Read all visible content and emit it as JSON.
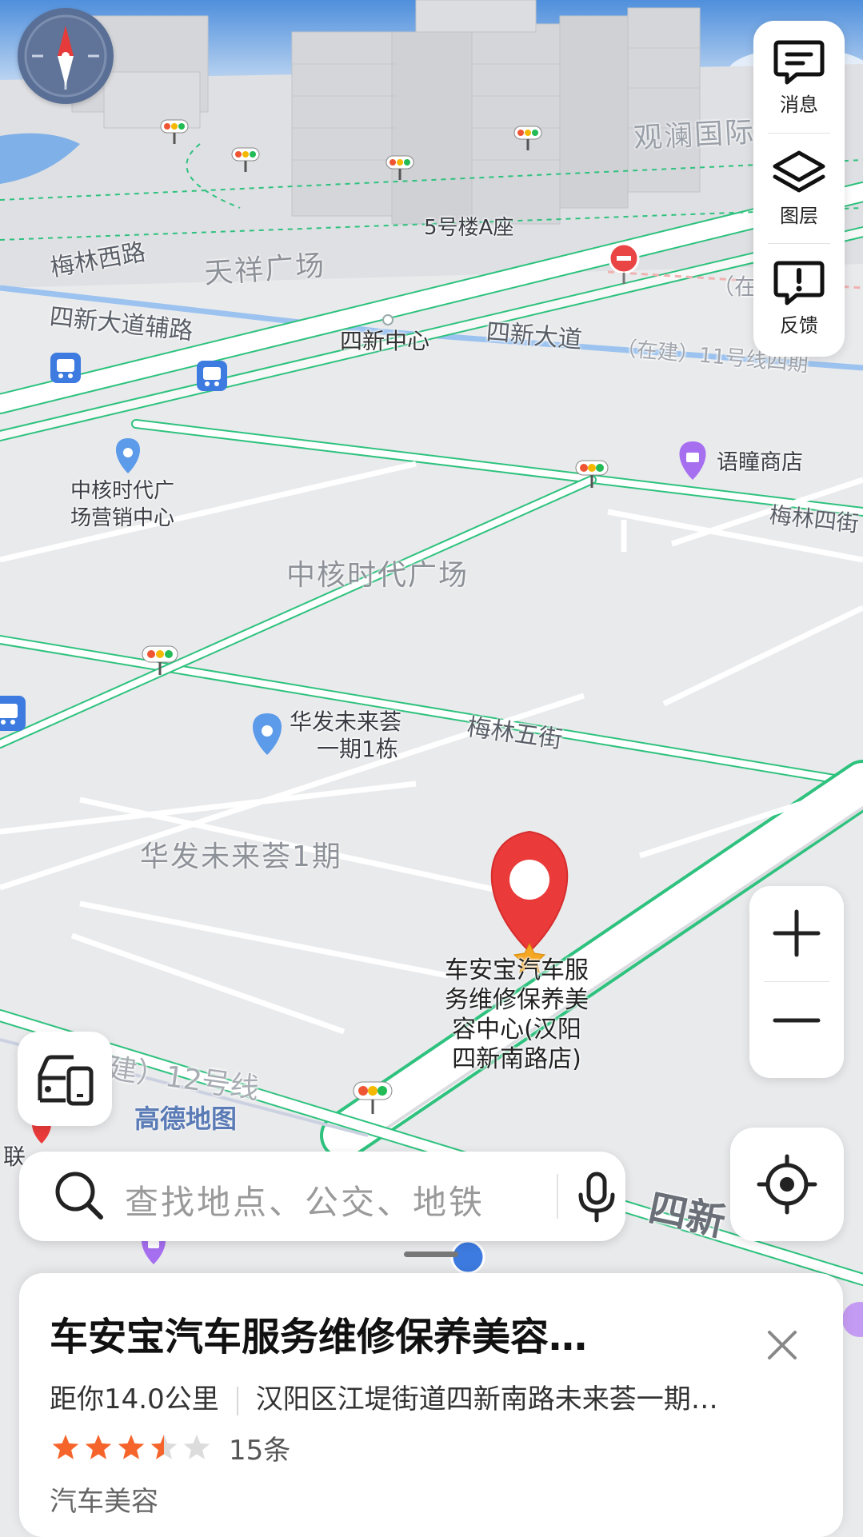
{
  "map": {
    "road_labels": {
      "meilin_west": "梅林西路",
      "sixin_aux": "四新大道辅路",
      "sixin_center": "四新中心",
      "sixin_avenue": "四新大道",
      "meilin_four": "梅林四街",
      "meilin_five": "梅林五街",
      "under_construction_11": "（在建）11号线四期",
      "under_construction_left": "（在",
      "line12": "建）12号线",
      "sixin_bottom": "四新"
    },
    "area_labels": {
      "tianxiang": "天祥广场",
      "zhonghe_plaza": "中核时代广场",
      "huafa_phase1": "华发未来荟1期",
      "guanlan": "观澜国际"
    },
    "poi_labels": {
      "building5a": "5号楼A座",
      "zhonghe_sales_1": "中核时代广",
      "zhonghe_sales_2": "场营销中心",
      "yutong_shop": "语瞳商店",
      "huafa_building_1": "华发未来荟",
      "huafa_building_2": "一期1栋",
      "target_1": "车安宝汽车服",
      "target_2": "务维修保养美",
      "target_3": "容中心(汉阳",
      "target_4": "四新南路店)",
      "lianfeng": "联"
    },
    "watermark": "高德地图"
  },
  "tools": {
    "messages": "消息",
    "layers": "图层",
    "feedback": "反馈"
  },
  "search": {
    "placeholder": "查找地点、公交、地铁"
  },
  "place_card": {
    "title": "车安宝汽车服务维修保养美容…",
    "distance": "距你14.0公里",
    "address": "汉阳区江堤街道四新南路未来荟一期…",
    "rating": 3.5,
    "review_count": "15条",
    "category": "汽车美容"
  },
  "colors": {
    "accent_green": "#2ec27e",
    "marker_red": "#ea3a3a",
    "star_orange": "#f5652b",
    "map_bg": "#e9eaec"
  }
}
